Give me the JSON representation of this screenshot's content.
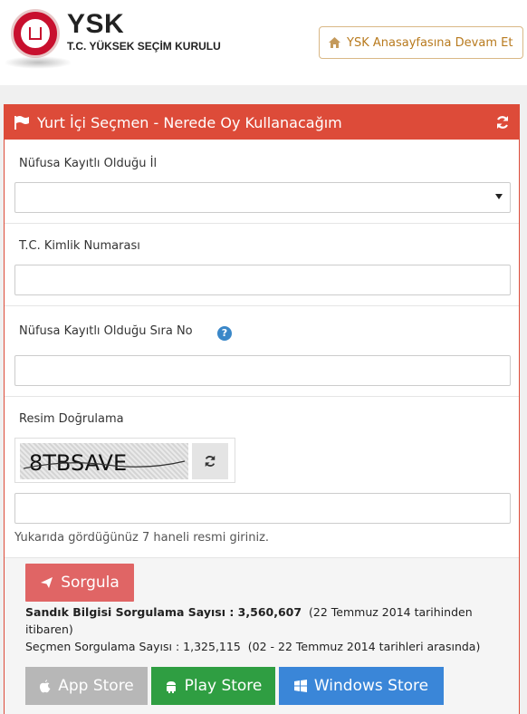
{
  "header": {
    "logo_short": "YSK",
    "logo_full": "T.C. YÜKSEK SEÇİM KURULU",
    "home_button": "YSK Anasayfasına Devam Et"
  },
  "panel": {
    "title": "Yurt İçi Seçmen - Nerede Oy Kullanacağım",
    "fields": {
      "province_label": "Nüfusa Kayıtlı Olduğu İl",
      "province_value": "",
      "tc_label": "T.C. Kimlik Numarası",
      "tc_value": "",
      "sira_label": "Nüfusa Kayıtlı Olduğu Sıra No",
      "sira_value": "",
      "captcha_label": "Resim Doğrulama",
      "captcha_text": "8TBSAVE",
      "captcha_value": "",
      "captcha_hint": "Yukarıda gördüğünüz 7 haneli resmi giriniz."
    },
    "query_button": "Sorgula",
    "stats": {
      "ballot_label": "Sandık Bilgisi Sorgulama Sayısı : 3,560,607",
      "ballot_note": "(22 Temmuz 2014 tarihinden itibaren)",
      "voter_label": "Seçmen Sorgulama Sayısı : 1,325,115",
      "voter_note": "(02 - 22 Temmuz 2014 tarihleri arasında)"
    },
    "stores": {
      "apple": "App Store",
      "play": "Play Store",
      "windows": "Windows Store"
    }
  },
  "colors": {
    "panel_header": "#dd4b39",
    "query_button": "#e06565",
    "app_store": "#b7b7b7",
    "play_store": "#2f9e42",
    "windows_store": "#3a86d8",
    "help_icon": "#3a87c8"
  }
}
